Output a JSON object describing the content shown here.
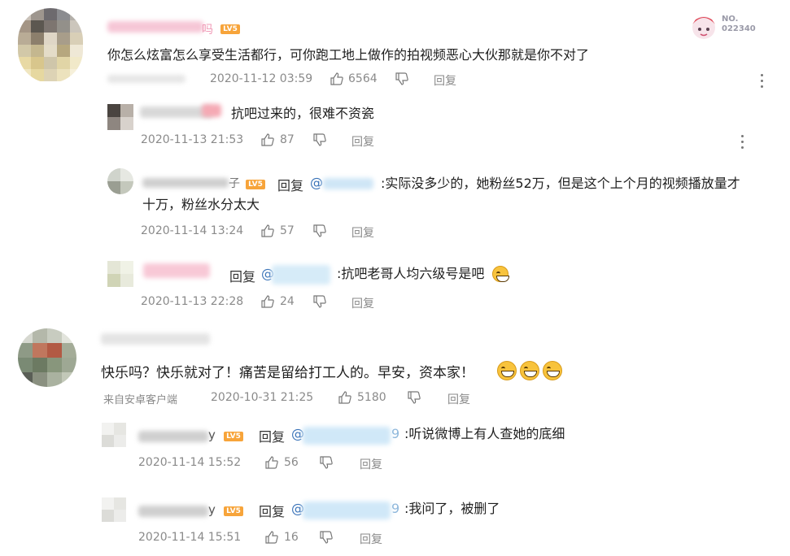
{
  "badge": {
    "lv": "LV5",
    "number": "NO.\n022340"
  },
  "comments": [
    {
      "text": "你怎么炫富怎么享受生活都行，可你跑工地上做作的拍视频恶心大伙那就是你不对了",
      "name_tail": "吗",
      "date": "2020-11-12 03:59",
      "likes": "6564",
      "reply": "回复"
    },
    {
      "text": "快乐吗？快乐就对了！痛苦是留给打工人的。早安，资本家！",
      "source": "来自安卓客户端",
      "date": "2020-10-31 21:25",
      "likes": "5180",
      "reply": "回复"
    }
  ],
  "replies_1": [
    {
      "text": "抗吧过来的，很难不资瓷",
      "date": "2020-11-13 21:53",
      "likes": "87",
      "reply": "回复"
    },
    {
      "name_tail": "子",
      "reply_label": "回复",
      "at": "@",
      "text1": ":实际没多少的，她粉丝52万，但是这个上个月的视频播放量才",
      "text2": "十万，粉丝水分太大",
      "date": "2020-11-14 13:24",
      "likes": "57",
      "reply": "回复"
    },
    {
      "reply_label": "回复",
      "at": "@",
      "text": ":抗吧老哥人均六级号是吧",
      "date": "2020-11-13 22:28",
      "likes": "24",
      "reply": "回复"
    }
  ],
  "replies_2": [
    {
      "name_tail": "y",
      "reply_label": "回复",
      "at": "@",
      "at_tail": "9",
      "text": ":听说微博上有人查她的底细",
      "date": "2020-11-14 15:52",
      "likes": "56",
      "reply": "回复"
    },
    {
      "name_tail": "y",
      "reply_label": "回复",
      "at": "@",
      "at_tail": "9",
      "text": ":我问了，被删了",
      "date": "2020-11-14 15:51",
      "likes": "16",
      "reply": "回复"
    }
  ],
  "colors": {
    "accent": "#3a73b8",
    "meta": "#8a8a8a",
    "lv": "#f7a43a",
    "pink": "#f4a9c2"
  }
}
